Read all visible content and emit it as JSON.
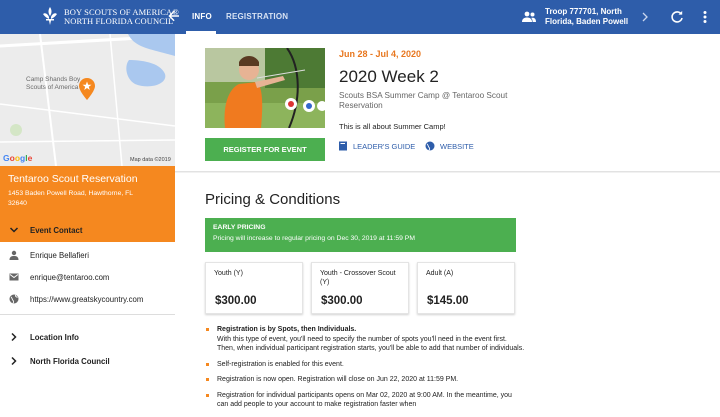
{
  "header": {
    "org_line1": "BOY SCOUTS OF AMERICA®",
    "org_line2": "NORTH FLORIDA COUNCIL",
    "tabs": [
      {
        "label": "INFO",
        "active": true
      },
      {
        "label": "REGISTRATION",
        "active": false
      }
    ],
    "troop_line1": "Troop 777701, North",
    "troop_line2": "Florida, Baden Powell",
    "icons": [
      "fleur-de-lis-logo",
      "back-arrow-icon",
      "group-icon",
      "chevron-right-icon",
      "refresh-icon",
      "more-vert-icon"
    ]
  },
  "map": {
    "place_label_line1": "Camp Shands Boy",
    "place_label_line2": "Scouts of America",
    "google": "Google",
    "map_data": "Map data ©2019",
    "pin_color": "#f5881f"
  },
  "venue": {
    "name": "Tentaroo Scout Reservation",
    "address_line1": "1453 Baden Powell Road, Hawthorne, FL",
    "address_line2": "32640",
    "color": "#f5881f"
  },
  "contact": {
    "section_label": "Event Contact",
    "name": "Enrique Bellafieri",
    "email": "enrique@tentaroo.com",
    "website": "https://www.greatskycountry.com"
  },
  "sections": [
    {
      "label": "Location Info"
    },
    {
      "label": "North Florida Council"
    }
  ],
  "event": {
    "dates": "Jun 28 - Jul 4, 2020",
    "title": "2020 Week 2",
    "subtitle": "Scouts BSA Summer Camp @ Tentaroo Scout Reservation",
    "description": "This is all about Summer Camp!",
    "register_label": "REGISTER FOR EVENT",
    "leaders_guide_label": "LEADER'S GUIDE",
    "website_label": "WEBSITE",
    "accent": "#e8771f",
    "button_color": "#4caf50"
  },
  "pricing": {
    "title": "Pricing & Conditions",
    "early_heading": "EARLY PRICING",
    "early_text": "Pricing will increase to regular pricing on Dec 30, 2019 at 11:59 PM",
    "cards": [
      {
        "name": "Youth (Y)",
        "price": "$300.00"
      },
      {
        "name": "Youth - Crossover Scout (Y)",
        "price": "$300.00"
      },
      {
        "name": "Adult (A)",
        "price": "$145.00"
      }
    ],
    "notes": [
      {
        "bold": "Registration is by Spots, then Individuals.",
        "text": "With this type of event, you'll need to specify the number of spots you'll need in the event first. Then, when individual participant registration starts, you'll be able to add that number of individuals."
      },
      {
        "bold": "",
        "text": "Self-registration is enabled for this event."
      },
      {
        "bold": "",
        "text": "Registration is now open. Registration will close on Jun 22, 2020 at 11:59 PM."
      },
      {
        "bold": "",
        "text": "Registration for individual participants opens on Mar 02, 2020 at 9:00 AM. In the meantime, you can add people to your account to make registration faster when"
      }
    ]
  }
}
